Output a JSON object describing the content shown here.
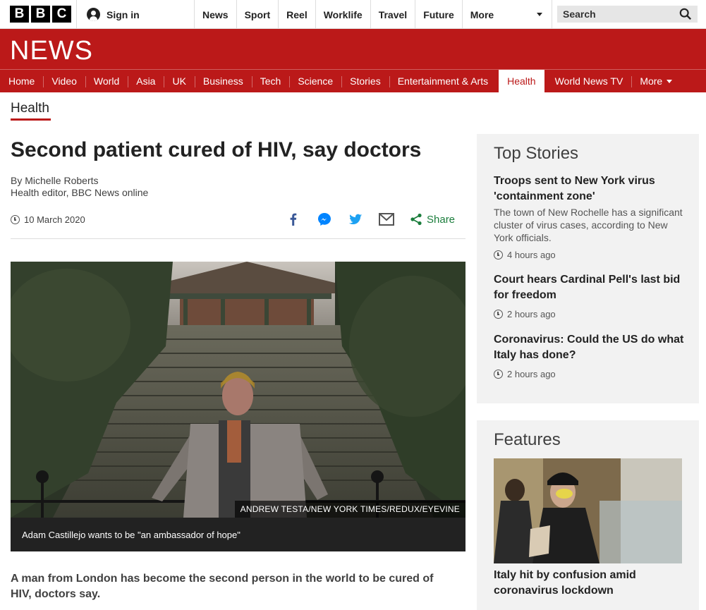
{
  "brand": {
    "letters": [
      "B",
      "B",
      "C"
    ]
  },
  "topbar": {
    "signin_label": "Sign in",
    "nav": [
      "News",
      "Sport",
      "Reel",
      "Worklife",
      "Travel",
      "Future"
    ],
    "more_label": "More",
    "search_label": "Search"
  },
  "header": {
    "title": "NEWS",
    "nav": [
      "Home",
      "Video",
      "World",
      "Asia",
      "UK",
      "Business",
      "Tech",
      "Science",
      "Stories",
      "Entertainment & Arts",
      "Health",
      "World News TV"
    ],
    "active": "Health",
    "more_label": "More"
  },
  "section": {
    "label": "Health"
  },
  "article": {
    "headline": "Second patient cured of HIV, say doctors",
    "author": "By Michelle Roberts",
    "author_role": "Health editor, BBC News online",
    "date": "10 March 2020",
    "share_label": "Share",
    "photo_credit": "ANDREW TESTA/NEW YORK TIMES/REDUX/EYEVINE",
    "photo_caption": "Adam Castillejo wants to be \"an ambassador of hope\"",
    "lede": "A man from London has become the second person in the world to be cured of HIV, doctors say."
  },
  "top_stories": {
    "heading": "Top Stories",
    "items": [
      {
        "title": "Troops sent to New York virus 'containment zone'",
        "summary": "The town of New Rochelle has a significant cluster of virus cases, according to New York officials.",
        "time": "4 hours ago"
      },
      {
        "title": "Court hears Cardinal Pell's last bid for freedom",
        "summary": "",
        "time": "2 hours ago"
      },
      {
        "title": "Coronavirus: Could the US do what Italy has done?",
        "summary": "",
        "time": "2 hours ago"
      }
    ]
  },
  "features": {
    "heading": "Features",
    "items": [
      {
        "title": "Italy hit by confusion amid coronavirus lockdown"
      }
    ]
  },
  "colors": {
    "brand_red": "#bb1919",
    "share_green": "#1b7d3c",
    "facebook": "#3b5998",
    "twitter": "#1da1f2",
    "messenger": "#0084ff"
  }
}
